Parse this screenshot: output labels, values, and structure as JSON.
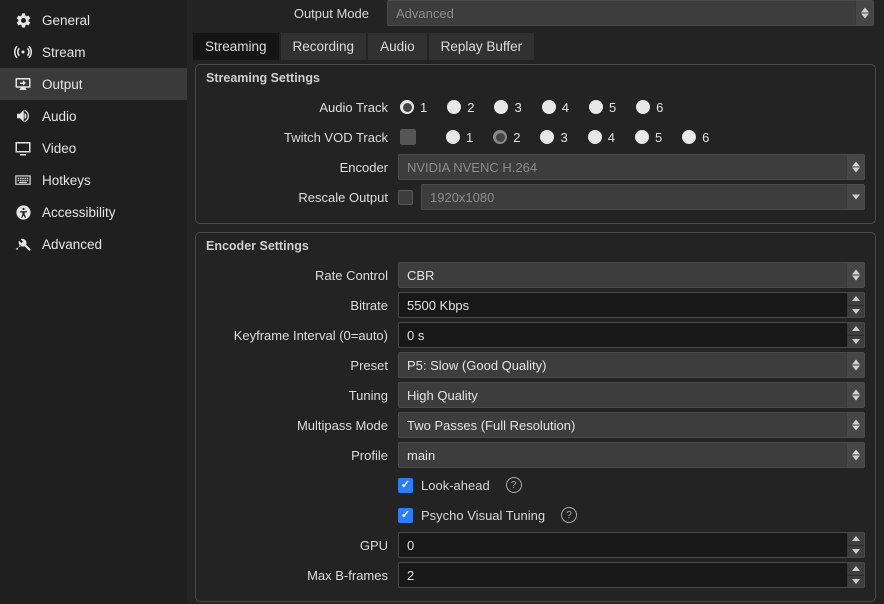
{
  "sidebar": {
    "items": [
      {
        "label": "General"
      },
      {
        "label": "Stream"
      },
      {
        "label": "Output"
      },
      {
        "label": "Audio"
      },
      {
        "label": "Video"
      },
      {
        "label": "Hotkeys"
      },
      {
        "label": "Accessibility"
      },
      {
        "label": "Advanced"
      }
    ]
  },
  "topbar": {
    "mode_label": "Output Mode",
    "mode_value": "Advanced"
  },
  "tabs": {
    "streaming": "Streaming",
    "recording": "Recording",
    "audio": "Audio",
    "replay": "Replay Buffer"
  },
  "streaming": {
    "title": "Streaming Settings",
    "audio_track_label": "Audio Track",
    "vod_track_label": "Twitch VOD Track",
    "tracks": [
      "1",
      "2",
      "3",
      "4",
      "5",
      "6"
    ],
    "encoder_label": "Encoder",
    "encoder_value": "NVIDIA NVENC H.264",
    "rescale_label": "Rescale Output",
    "rescale_value": "1920x1080"
  },
  "encoder": {
    "title": "Encoder Settings",
    "rate_control_label": "Rate Control",
    "rate_control_value": "CBR",
    "bitrate_label": "Bitrate",
    "bitrate_value": "5500 Kbps",
    "keyframe_label": "Keyframe Interval (0=auto)",
    "keyframe_value": "0 s",
    "preset_label": "Preset",
    "preset_value": "P5: Slow (Good Quality)",
    "tuning_label": "Tuning",
    "tuning_value": "High Quality",
    "multipass_label": "Multipass Mode",
    "multipass_value": "Two Passes (Full Resolution)",
    "profile_label": "Profile",
    "profile_value": "main",
    "lookahead_label": "Look-ahead",
    "psycho_label": "Psycho Visual Tuning",
    "gpu_label": "GPU",
    "gpu_value": "0",
    "bframes_label": "Max B-frames",
    "bframes_value": "2"
  }
}
